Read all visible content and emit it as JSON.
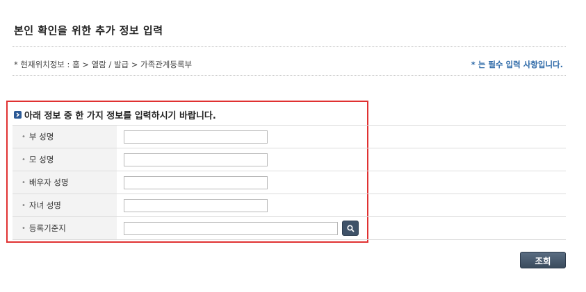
{
  "page": {
    "title": "본인 확인을 위한 추가 정보 입력"
  },
  "breadcrumb": {
    "text": "* 현재위치정보 : 홈 > 열람 / 발급 > 가족관계등록부"
  },
  "required_note": "* 는 필수 입력 사항입니다.",
  "form": {
    "section_title": "아래 정보 중 한 가지 정보를 입력하시기 바랍니다.",
    "rows": [
      {
        "label": "부 성명",
        "value": ""
      },
      {
        "label": "모 성명",
        "value": ""
      },
      {
        "label": "배우자 성명",
        "value": ""
      },
      {
        "label": "자녀 성명",
        "value": ""
      },
      {
        "label": "등록기준지",
        "value": ""
      }
    ],
    "bullet": "•"
  },
  "buttons": {
    "submit_label": "조회"
  },
  "colors": {
    "required_note": "#2e6aa8",
    "highlight_border": "#e03131",
    "button_bg": "#3f5268"
  },
  "icons": {
    "section_marker": "arrow-right-icon",
    "search": "search-icon"
  }
}
